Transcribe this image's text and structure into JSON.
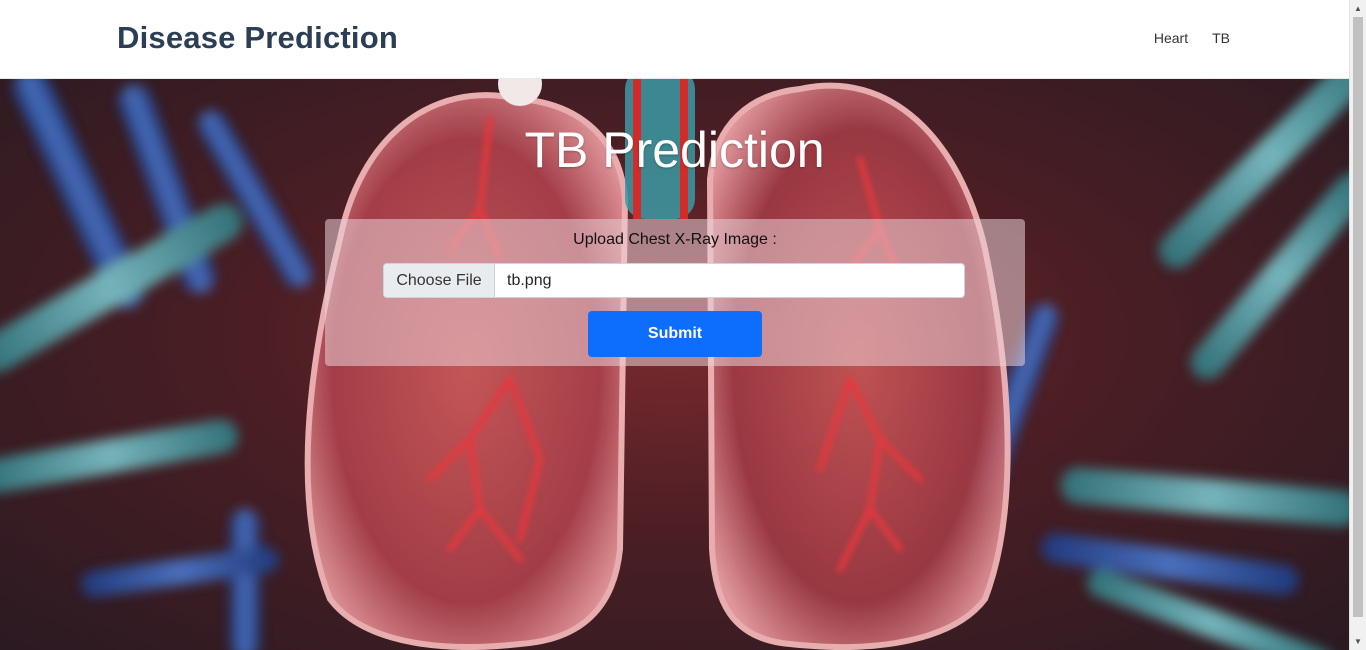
{
  "navbar": {
    "brand": "Disease Prediction",
    "links": [
      {
        "label": "Heart"
      },
      {
        "label": "TB"
      }
    ]
  },
  "hero": {
    "title": "TB Prediction"
  },
  "upload": {
    "label": "Upload Chest X-Ray Image :",
    "choose_file_label": "Choose File",
    "selected_file": "tb.png",
    "submit_label": "Submit"
  },
  "colors": {
    "brand_text": "#2c3e56",
    "submit_button": "#0d6efd",
    "title_text": "#ffffff"
  },
  "icons": {
    "scroll_up": "triangle-up-icon",
    "scroll_down": "triangle-down-icon"
  }
}
